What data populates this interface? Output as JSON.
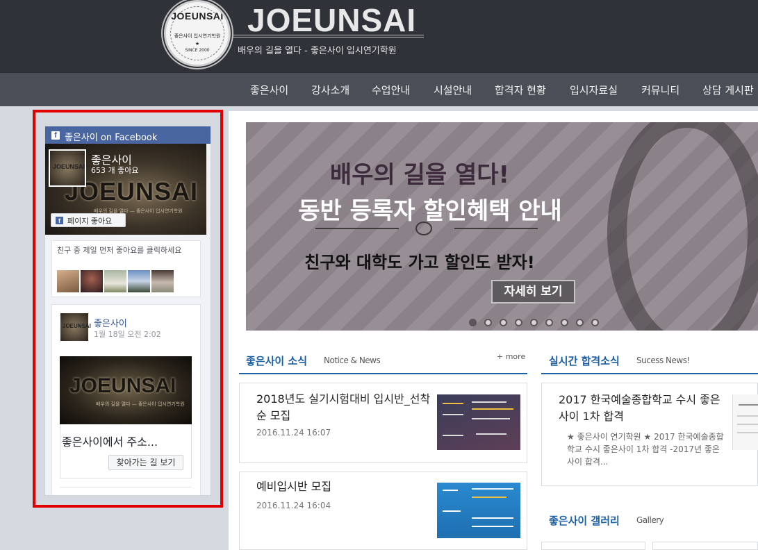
{
  "header": {
    "badge_name": "JOEUNSAI",
    "badge_sub": "좋은사이 입시연기학원",
    "badge_star": "★",
    "badge_since": "SINCE 2000",
    "logo_word": "JOEUNSAI",
    "tagline": "배우의 길을 열다 - 좋은사이 입시연기학원"
  },
  "nav": {
    "items": [
      "좋은사이",
      "강사소개",
      "수업안내",
      "시설안내",
      "합격자 현황",
      "입시자료실",
      "커뮤니티",
      "상담 게시판"
    ]
  },
  "facebook": {
    "header_title": "좋은사이 on Facebook",
    "cover_word": "JOEUNSAI",
    "cover_sub": "배우의 길을 열다 — 좋은사이 입시연기학원",
    "thumb_word": "JOEUNSAI",
    "page_name": "좋은사이",
    "likes": "653 개 좋아요",
    "like_button": "페이지 좋아요",
    "friends_text": "친구 중 제일 먼저 좋아요를 클릭하세요",
    "post": {
      "avatar_word": "JOEUNSAI",
      "name": "좋은사이",
      "time": "1월 18일 오전 2:02",
      "image_word": "JOEUNSAI",
      "image_sub": "배우의 길을 열다 — 좋은사이 입시연기학원",
      "caption": "좋은사이에서 주소...",
      "button": "찾아가는 길 보기"
    }
  },
  "banner": {
    "line1": "배우의 길을 열다!",
    "line2": "동반 등록자 할인혜택 안내",
    "line3": "친구와 대학도 가고 할인도 받자!",
    "button": "자세히 보기",
    "dots": 9,
    "active_dot": 0
  },
  "news": {
    "title": "좋은사이 소식",
    "subtitle": "Notice & News",
    "more": "+ more",
    "items": [
      {
        "title": "2018년도 실기시험대비 입시반_선착순 모집",
        "date": "2016.11.24 16:07"
      },
      {
        "title": "예비입시반 모집",
        "date": "2016.11.24 16:04"
      }
    ]
  },
  "pass": {
    "title": "실시간 합격소식",
    "subtitle": "Sucess News!",
    "item": {
      "title": "2017 한국예술종합학교 수시 좋은사이 1차 합격",
      "desc": "★ 좋은사이 연기학원 ★ 2017 한국예술종합학교 수시 좋은사이 1차 합격 -2017년 좋은사이 합격..."
    }
  },
  "gallery": {
    "title": "좋은사이 갤러리",
    "subtitle": "Gallery"
  },
  "colors": {
    "header_bg": "#2f3238",
    "nav_bg": "#4a4f57",
    "facebook_blue": "#4a66a0",
    "accent_blue": "#1b5fa5",
    "highlight_red": "#e00000"
  }
}
